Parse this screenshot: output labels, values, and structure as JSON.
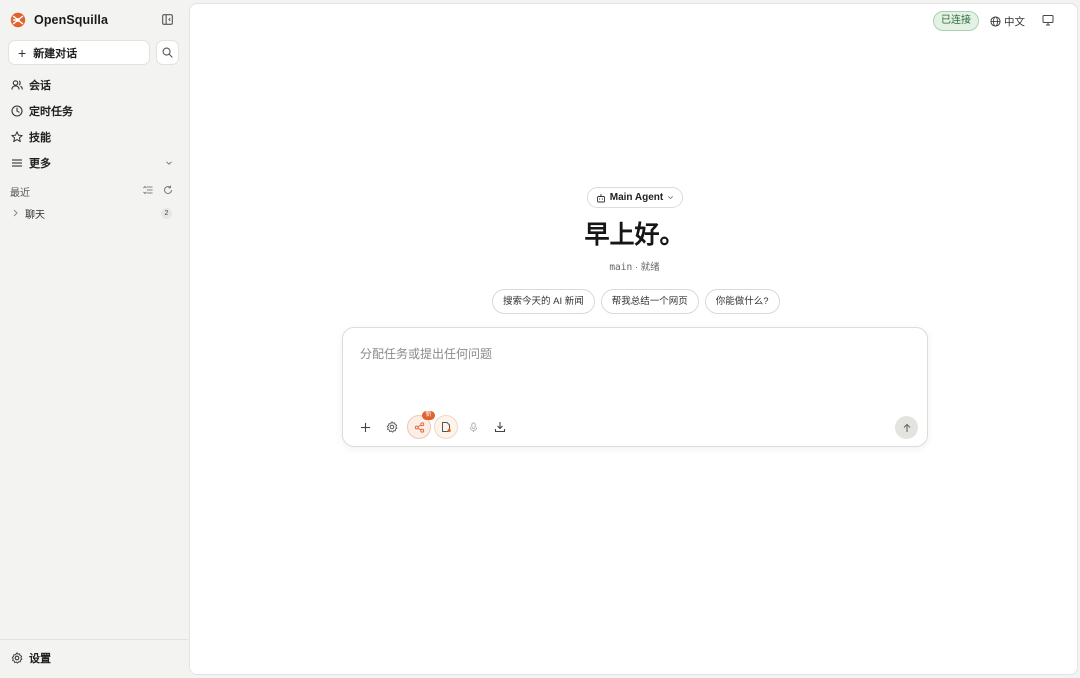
{
  "app": {
    "name": "OpenSquilla",
    "accent": "#e0622d"
  },
  "sidebar": {
    "new_chat_label": "新建对话",
    "nav": [
      {
        "label": "会话",
        "icon": "users-icon"
      },
      {
        "label": "定时任务",
        "icon": "clock-icon"
      },
      {
        "label": "技能",
        "icon": "star-icon"
      },
      {
        "label": "更多",
        "icon": "menu-icon"
      }
    ],
    "recent_title": "最近",
    "chat_group": {
      "label": "聊天",
      "count": "2"
    },
    "settings_label": "设置"
  },
  "header": {
    "status": "已连接",
    "status_color": "#2d6b3a",
    "language": "中文"
  },
  "main": {
    "agent_label": "Main Agent",
    "greeting": "早上好。",
    "agent_id": "main",
    "separator": "·",
    "agent_state": "就绪",
    "suggestions": [
      "搜索今天的 AI 新闻",
      "帮我总结一个网页",
      "你能做什么?"
    ],
    "composer_placeholder": "分配任务或提出任何问题",
    "new_badge": "新"
  }
}
